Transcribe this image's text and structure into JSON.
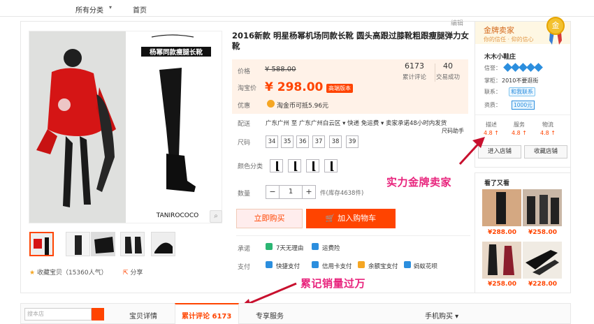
{
  "topnav": {
    "all_categories": "所有分类",
    "home": "首页"
  },
  "edit_label": "编辑",
  "gallery": {
    "headline": "杨幂同款瘦腿长靴",
    "brand": "TANIROCOCO",
    "watermark": "木木小鞋庄"
  },
  "actions": {
    "favorite": "收藏宝贝（15360人气）",
    "share": "分享"
  },
  "product": {
    "title": "2016新款 明星杨幂机场同款长靴 圆头高跟过膝靴粗跟瘦腿弹力女靴",
    "price_label": "价格",
    "original_price": "¥ 588.00",
    "taobao_price_label": "淘宝价",
    "current_price": "¥ 298.00",
    "price_tag": "高端版本",
    "reviews_count": "6173",
    "reviews_label": "累计评论",
    "sales_count": "40",
    "sales_label": "交易成功",
    "promo_label": "优惠",
    "promo_text": "淘金币可抵5.96元",
    "shipping_label": "配送",
    "shipping_text": "广东广州 至  广东广州白云区 ▾   快递 免运费 ▾   卖家承诺48小时内发货",
    "shipping_text2": "尺码助手",
    "size_label": "尺码",
    "sizes": [
      "34",
      "35",
      "36",
      "37",
      "38",
      "39"
    ],
    "color_label": "颜色分类",
    "quantity_label": "数量",
    "quantity": "1",
    "stock": "件(库存4638件)",
    "buy_now": "立即购买",
    "add_cart": "加入购物车",
    "promise_label": "承诺",
    "promise_7day": "7天无理由",
    "promise_insurance": "运费险",
    "pay_label": "支付",
    "pay_methods": [
      "快捷支付",
      "信用卡支付",
      "余额宝支付",
      "蚂蚁花呗"
    ]
  },
  "seller": {
    "gold_title": "金牌卖家",
    "gold_sub": "你的信任 · 仰的信心",
    "medal": "金",
    "shop_name": "木木小鞋庄",
    "credit_label": "信誉：",
    "seller_label": "掌柜：",
    "seller_value": "2010不要逛街",
    "contact_label": "联系：",
    "contact_value": "和我联系",
    "qual_label": "资质：",
    "qual_value": "1000元",
    "dsr": [
      {
        "k": "描述",
        "v": "4.8 ↑"
      },
      {
        "k": "服务",
        "v": "4.8 ↑"
      },
      {
        "k": "物流",
        "v": "4.8 ↑"
      }
    ],
    "enter_shop": "进入店铺",
    "save_shop": "收藏店铺"
  },
  "also_viewed": {
    "title": "看了又看",
    "prices": [
      "¥288.00",
      "¥258.00",
      "¥258.00",
      "¥228.00"
    ]
  },
  "annotations": {
    "gold_seller": "实力金牌卖家",
    "sales": "累记销量过万"
  },
  "tabs": {
    "search_placeholder": "搜本店",
    "detail": "宝贝详情",
    "reviews": "累计评论  6173",
    "service": "专享服务",
    "mobile": "手机购买  ▾"
  },
  "colors": {
    "accent": "#ff4400",
    "annotation": "#e8237c",
    "gold": "#f3c12e"
  }
}
